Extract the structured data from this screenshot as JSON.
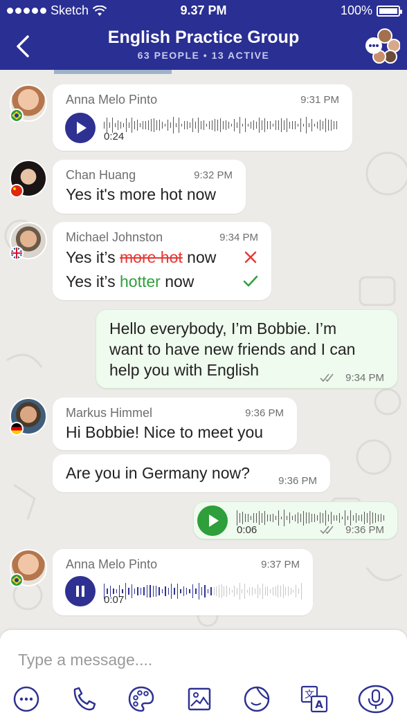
{
  "status_bar": {
    "carrier": "Sketch",
    "time": "9.37 PM",
    "battery": "100%"
  },
  "header": {
    "title": "English Practice Group",
    "subtitle": "63 PEOPLE  •  13 ACTIVE"
  },
  "messages": [
    {
      "sender": "Anna Melo Pinto",
      "time": "9:31 PM",
      "type": "voice",
      "duration": "0:24",
      "flag": "brazil"
    },
    {
      "sender": "Chan Huang",
      "time": "9:32 PM",
      "text": "Yes it's more hot now",
      "flag": "china"
    },
    {
      "sender": "Michael Johnston",
      "time": "9:34 PM",
      "flag": "uk",
      "correction": {
        "prefix": "Yes it’s ",
        "wrong": "more hot",
        "wrong_suffix": " now",
        "fixed_prefix": "Yes it’s ",
        "fixed": "hotter",
        "fixed_suffix": " now"
      }
    },
    {
      "outgoing": true,
      "time": "9:34 PM",
      "lines": [
        "Hello everybody, I’m Bobbie. I’m",
        "want to have new friends and I can",
        "help you with English"
      ]
    },
    {
      "sender": "Markus Himmel",
      "time": "9:36 PM",
      "text": "Hi Bobbie! Nice to meet you",
      "flag": "germany"
    },
    {
      "time": "9:36 PM",
      "text": "Are you in Germany now?"
    },
    {
      "outgoing": true,
      "type": "voice",
      "duration": "0:06",
      "time": "9:36 PM"
    },
    {
      "sender": "Anna Melo Pinto",
      "time": "9:37 PM",
      "type": "voice",
      "duration": "0:07",
      "state": "playing",
      "progress": 0.5,
      "flag": "brazil"
    }
  ],
  "composer": {
    "placeholder": "Type a message...."
  },
  "toolbar_icons": [
    "more-icon",
    "phone-icon",
    "palette-icon",
    "image-icon",
    "sticker-icon",
    "translate-icon",
    "microphone-icon"
  ],
  "colors": {
    "header": "#2a2f93",
    "accent_blue": "#2e3192",
    "accent_green": "#2e9f3a",
    "correction_red": "#e53935"
  }
}
